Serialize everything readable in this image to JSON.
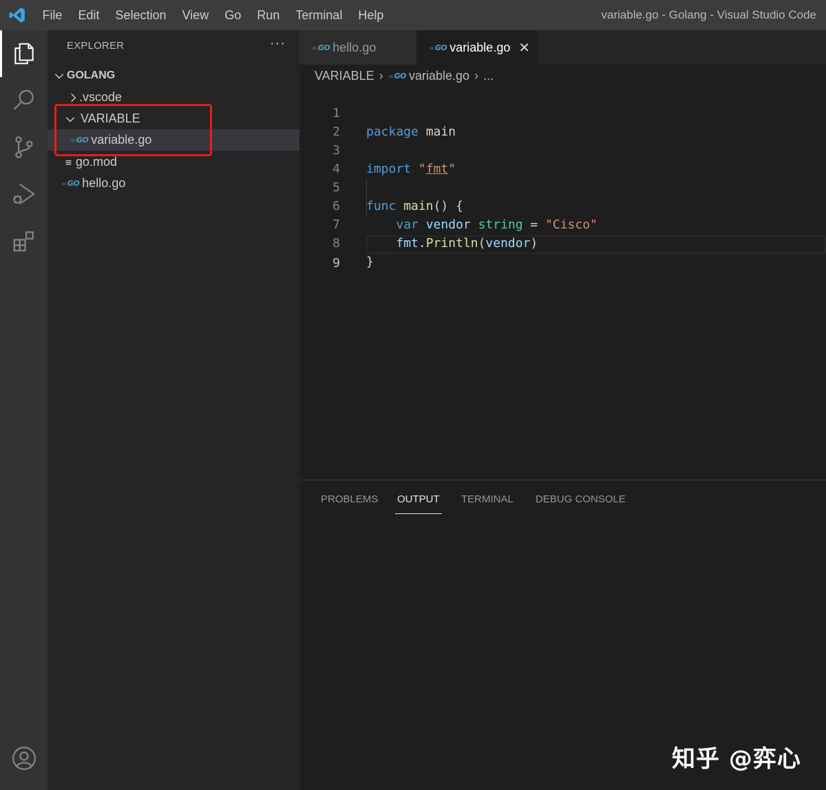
{
  "titlebar": {
    "menu": [
      "File",
      "Edit",
      "Selection",
      "View",
      "Go",
      "Run",
      "Terminal",
      "Help"
    ],
    "window_title": "variable.go - Golang - Visual Studio Code"
  },
  "activity": {
    "items": [
      "explorer-icon",
      "search-icon",
      "source-control-icon",
      "run-debug-icon",
      "extensions-icon",
      "account-icon"
    ]
  },
  "explorer": {
    "title": "EXPLORER",
    "more": "···",
    "root": "GOLANG",
    "items": [
      ".vscode",
      "VARIABLE",
      "variable.go",
      "go.mod",
      "hello.go"
    ],
    "go_badge": "GO"
  },
  "tabs": [
    {
      "label": "hello.go",
      "active": false
    },
    {
      "label": "variable.go",
      "active": true
    }
  ],
  "breadcrumb": [
    "VARIABLE",
    "variable.go",
    "..."
  ],
  "code": {
    "line_numbers": [
      "1",
      "2",
      "3",
      "4",
      "5",
      "6",
      "7",
      "8",
      "9"
    ],
    "current_line": "9"
  },
  "panel": {
    "tabs": [
      "PROBLEMS",
      "OUTPUT",
      "TERMINAL",
      "DEBUG CONSOLE"
    ],
    "active_tab": "OUTPUT"
  },
  "watermark": "知乎 @弈心",
  "colors": {
    "highlight": "#e0201b",
    "keyword": "#569cd6",
    "string": "#ce9178",
    "go": "#519aba"
  }
}
